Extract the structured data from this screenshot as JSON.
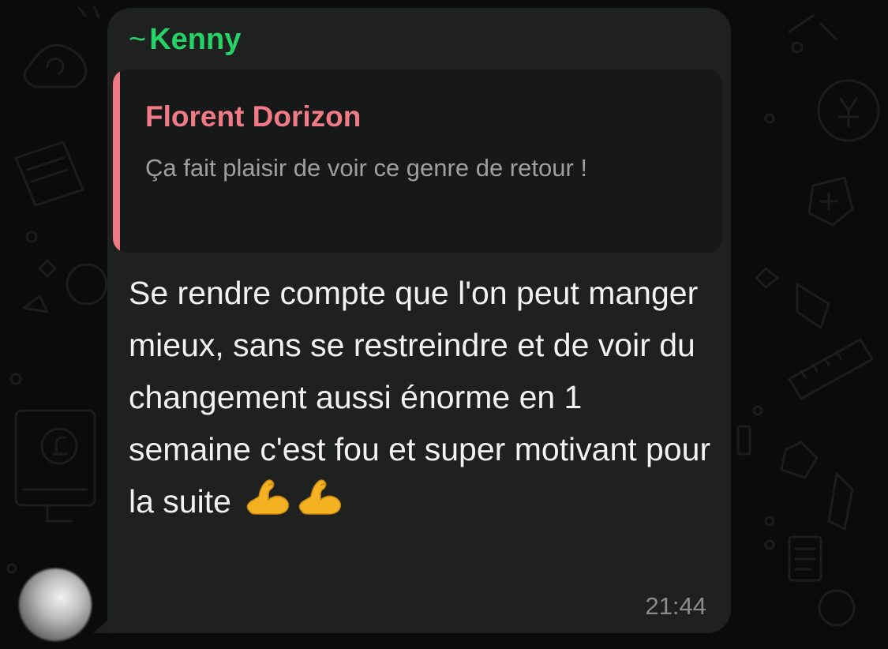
{
  "chat": {
    "sender_name": "Kenny",
    "sender_prefix": "~",
    "sender_color": "#25d366",
    "quoted": {
      "author": "Florent Dorizon",
      "text": "Ça fait plaisir de voir ce genre de retour !",
      "accent_color": "#f17a87"
    },
    "message": {
      "text": "Se rendre compte que l'on peut manger mieux, sans se restreindre et de voir du changement aussi énorme en 1 semaine c'est fou et super motivant pour la suite",
      "emojis": [
        "flexed-biceps-icon",
        "flexed-biceps-icon"
      ]
    },
    "timestamp": "21:44"
  }
}
